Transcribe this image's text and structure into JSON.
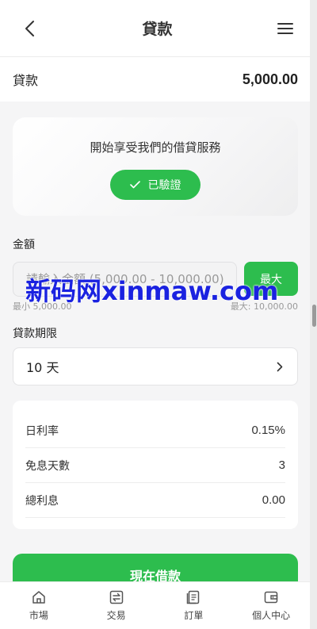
{
  "header": {
    "title": "貸款",
    "back_icon": "chevron-left-icon",
    "menu_icon": "menu-icon"
  },
  "summary": {
    "label": "貸款",
    "value": "5,000.00"
  },
  "verify": {
    "text": "開始享受我們的借貸服務",
    "badge_label": "已驗證"
  },
  "amount": {
    "label": "金額",
    "placeholder": "請輸入金額 (5,000.00 - 10,000.00)",
    "max_label": "最大",
    "min_hint": "最小 5,000.00",
    "max_hint": "最大: 10,000.00"
  },
  "term": {
    "label": "貸款期限",
    "value": "10 天"
  },
  "info": [
    {
      "label": "日利率",
      "value": "0.15%"
    },
    {
      "label": "免息天數",
      "value": "3"
    },
    {
      "label": "總利息",
      "value": "0.00"
    }
  ],
  "borrow_button": "現在借款",
  "tabbar": [
    {
      "label": "市場",
      "icon": "home-icon"
    },
    {
      "label": "交易",
      "icon": "swap-icon"
    },
    {
      "label": "訂單",
      "icon": "orders-icon"
    },
    {
      "label": "個人中心",
      "icon": "wallet-icon"
    }
  ],
  "watermark": "新码网xinmaw.com",
  "colors": {
    "accent": "#2dbd4e",
    "watermark": "#1a22e0"
  }
}
